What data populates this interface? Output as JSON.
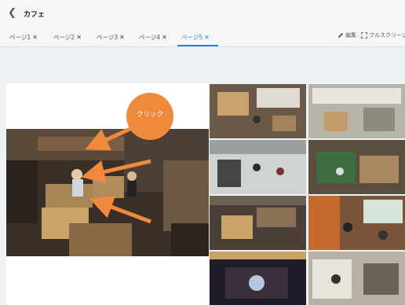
{
  "header": {
    "title": "カフェ"
  },
  "tabs": [
    {
      "label": "ページ1",
      "active": false
    },
    {
      "label": "ページ2",
      "active": false
    },
    {
      "label": "ページ3",
      "active": false
    },
    {
      "label": "ページ4",
      "active": false
    },
    {
      "label": "ページ5",
      "active": true
    }
  ],
  "tab_close_glyph": "✕",
  "toolbar": {
    "edit_label": "編集",
    "fullscreen_label": "フルスクリーン"
  },
  "annotation": {
    "click_label": "クリック",
    "color": "#ef8a3d"
  },
  "colors": {
    "accent": "#2f80c8"
  },
  "icons": {
    "back": "chevron-left-icon",
    "edit": "pencil-icon",
    "fullscreen": "fullscreen-icon"
  }
}
